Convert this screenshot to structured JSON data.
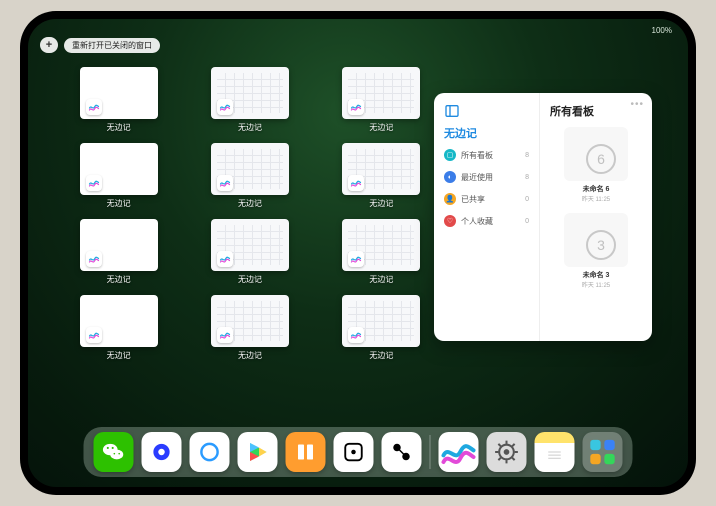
{
  "status": {
    "time": "",
    "right": "100%"
  },
  "toolbar": {
    "plus": "+",
    "reopen": "重新打开已关闭的窗口"
  },
  "windows": [
    {
      "kind": "blank",
      "label": "无边记"
    },
    {
      "kind": "cal",
      "label": "无边记"
    },
    {
      "kind": "cal",
      "label": "无边记"
    },
    {
      "kind": "blank",
      "label": "无边记"
    },
    {
      "kind": "cal",
      "label": "无边记"
    },
    {
      "kind": "cal",
      "label": "无边记"
    },
    {
      "kind": "blank",
      "label": "无边记"
    },
    {
      "kind": "cal",
      "label": "无边记"
    },
    {
      "kind": "cal",
      "label": "无边记"
    },
    {
      "kind": "blank",
      "label": "无边记"
    },
    {
      "kind": "cal",
      "label": "无边记"
    },
    {
      "kind": "cal",
      "label": "无边记"
    }
  ],
  "panel": {
    "title": "无边记",
    "rightTitle": "所有看板",
    "more": "•••",
    "categories": [
      {
        "label": "所有看板",
        "count": "8",
        "color": "#16b8c7",
        "glyph": "▢"
      },
      {
        "label": "最近使用",
        "count": "8",
        "color": "#3b7de8",
        "glyph": "◐"
      },
      {
        "label": "已共享",
        "count": "0",
        "color": "#f5a623",
        "glyph": "👤"
      },
      {
        "label": "个人收藏",
        "count": "0",
        "color": "#e24a4a",
        "glyph": "♡"
      }
    ],
    "boards": [
      {
        "name": "未命名 6",
        "date": "昨天 11:25",
        "digit": "6"
      },
      {
        "name": "未命名 3",
        "date": "昨天 11:25",
        "digit": "3"
      }
    ]
  },
  "dock": [
    {
      "name": "wechat",
      "bg": "#2dc100",
      "glyph": "●"
    },
    {
      "name": "quark-hd",
      "bg": "#ffffff",
      "glyph": "◉"
    },
    {
      "name": "quark",
      "bg": "#ffffff",
      "glyph": "○"
    },
    {
      "name": "play",
      "bg": "#ffffff",
      "glyph": "▶"
    },
    {
      "name": "books",
      "bg": "#ff9d2f",
      "glyph": "▮▮"
    },
    {
      "name": "dice",
      "bg": "#ffffff",
      "glyph": "⊡"
    },
    {
      "name": "graph",
      "bg": "#ffffff",
      "glyph": "⚭"
    },
    {
      "name": "freeform",
      "bg": "#ffffff",
      "glyph": "〰"
    },
    {
      "name": "settings",
      "bg": "#dcdcdc",
      "glyph": "⚙"
    },
    {
      "name": "notes",
      "bg": "#fff7b0",
      "glyph": "≣"
    },
    {
      "name": "app-library",
      "bg": "#6aa9d6",
      "glyph": "⊞"
    }
  ]
}
